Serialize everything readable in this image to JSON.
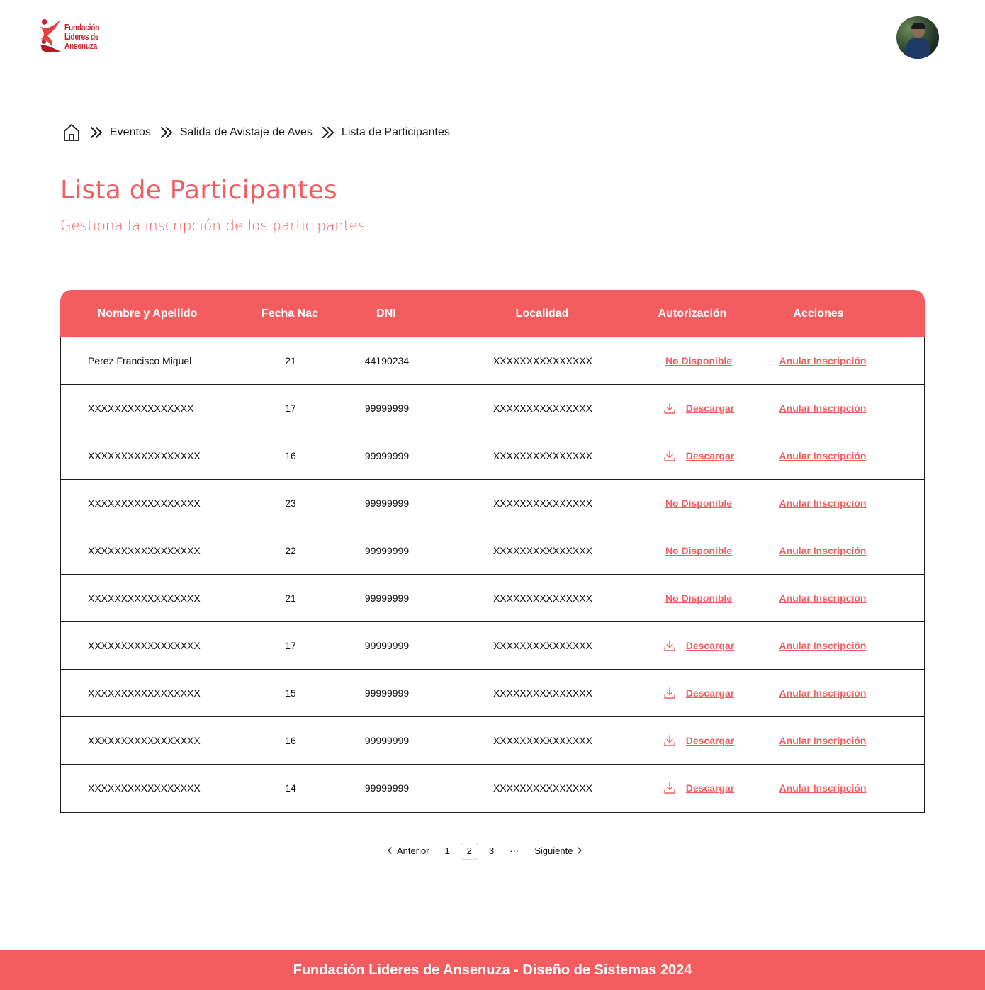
{
  "header": {
    "logo_lines": [
      "Fundación",
      "Lideres de",
      "Ansenuza"
    ],
    "avatar_label": "user-avatar"
  },
  "breadcrumb": {
    "items": [
      "Eventos",
      "Salida de Avistaje de Aves",
      "Lista de Participantes"
    ]
  },
  "page": {
    "title": "Lista de Participantes",
    "subtitle": "Gestiona la inscripción de los participantes"
  },
  "table": {
    "headers": {
      "name": "Nombre y Apellido",
      "fecha": "Fecha Nac",
      "dni": "DNI",
      "localidad": "Localidad",
      "autorizacion": "Autorización",
      "acciones": "Acciones"
    },
    "rows": [
      {
        "name": "Perez Francisco Miguel",
        "fecha": "21",
        "dni": "44190234",
        "localidad": "XXXXXXXXXXXXXXX",
        "autorizacion": "No Disponible",
        "download": false,
        "accion": "Anular Inscripción"
      },
      {
        "name": "XXXXXXXXXXXXXXXX",
        "fecha": "17",
        "dni": "99999999",
        "localidad": "XXXXXXXXXXXXXXX",
        "autorizacion": "Descargar",
        "download": true,
        "accion": "Anular Inscripción"
      },
      {
        "name": "XXXXXXXXXXXXXXXXX",
        "fecha": "16",
        "dni": "99999999",
        "localidad": "XXXXXXXXXXXXXXX",
        "autorizacion": "Descargar",
        "download": true,
        "accion": "Anular Inscripción"
      },
      {
        "name": "XXXXXXXXXXXXXXXXX",
        "fecha": "23",
        "dni": "99999999",
        "localidad": "XXXXXXXXXXXXXXX",
        "autorizacion": "No Disponible",
        "download": false,
        "accion": "Anular Inscripción"
      },
      {
        "name": "XXXXXXXXXXXXXXXXX",
        "fecha": "22",
        "dni": "99999999",
        "localidad": "XXXXXXXXXXXXXXX",
        "autorizacion": "No Disponible",
        "download": false,
        "accion": "Anular Inscripción"
      },
      {
        "name": "XXXXXXXXXXXXXXXXX",
        "fecha": "21",
        "dni": "99999999",
        "localidad": "XXXXXXXXXXXXXXX",
        "autorizacion": "No Disponible",
        "download": false,
        "accion": "Anular Inscripción"
      },
      {
        "name": "XXXXXXXXXXXXXXXXX",
        "fecha": "17",
        "dni": "99999999",
        "localidad": "XXXXXXXXXXXXXXX",
        "autorizacion": "Descargar",
        "download": true,
        "accion": "Anular Inscripción"
      },
      {
        "name": "XXXXXXXXXXXXXXXXX",
        "fecha": "15",
        "dni": "99999999",
        "localidad": "XXXXXXXXXXXXXXX",
        "autorizacion": "Descargar",
        "download": true,
        "accion": "Anular Inscripción"
      },
      {
        "name": "XXXXXXXXXXXXXXXXX",
        "fecha": "16",
        "dni": "99999999",
        "localidad": "XXXXXXXXXXXXXXX",
        "autorizacion": "Descargar",
        "download": true,
        "accion": "Anular Inscripción"
      },
      {
        "name": "XXXXXXXXXXXXXXXXX",
        "fecha": "14",
        "dni": "99999999",
        "localidad": "XXXXXXXXXXXXXXX",
        "autorizacion": "Descargar",
        "download": true,
        "accion": "Anular Inscripción"
      }
    ]
  },
  "pagination": {
    "prev_label": "Anterior",
    "pages": [
      "1",
      "2",
      "3"
    ],
    "current_page": "2",
    "ellipsis": "···",
    "next_label": "Siguiente"
  },
  "footer": {
    "text": "Fundación Lideres de Ansenuza - Diseño de Sistemas 2024"
  },
  "colors": {
    "accent": "#f45d5f",
    "border": "#1a1a1a"
  }
}
